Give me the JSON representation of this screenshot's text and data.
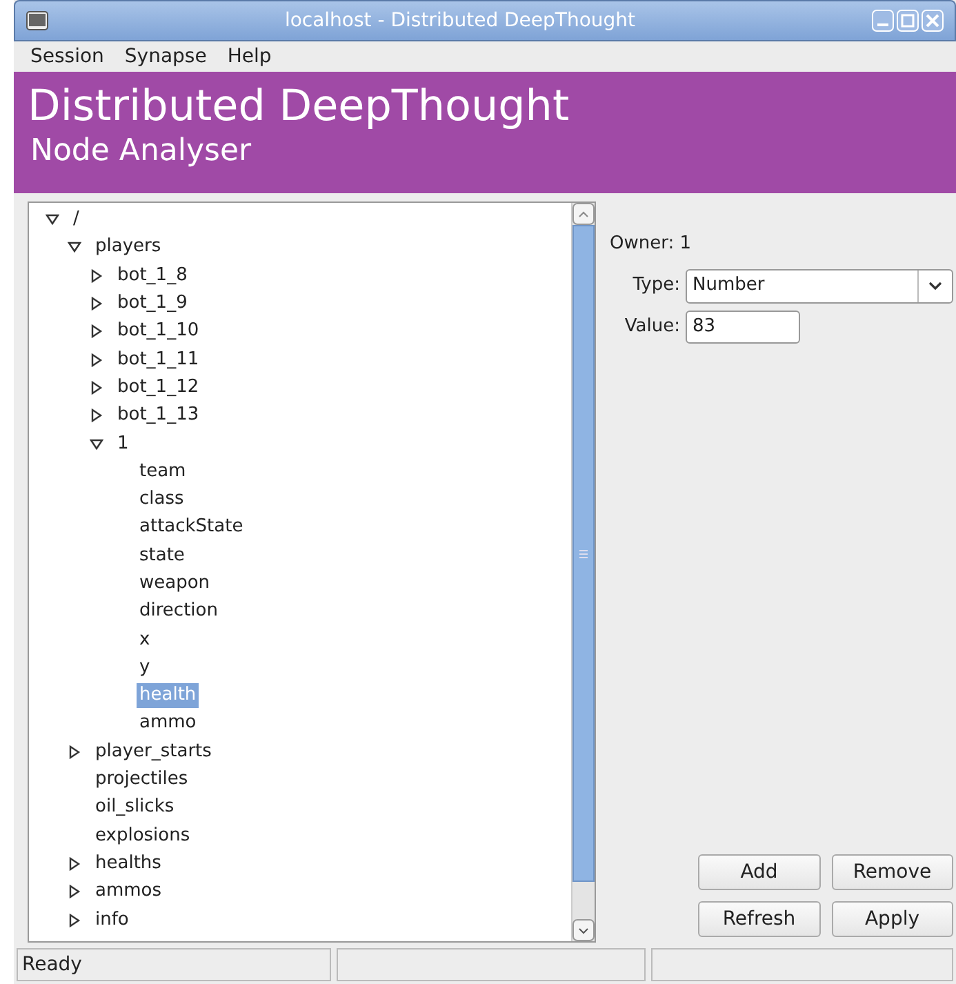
{
  "window": {
    "title": "localhost - Distributed DeepThought"
  },
  "menu": [
    "Session",
    "Synapse",
    "Help"
  ],
  "banner": {
    "title": "Distributed DeepThought",
    "subtitle": "Node Analyser"
  },
  "tree": [
    {
      "label": "/",
      "expanded": true,
      "selected": false,
      "children": [
        {
          "label": "players",
          "expanded": true,
          "selected": false,
          "children": [
            {
              "label": "bot_1_8",
              "expanded": false,
              "selected": false
            },
            {
              "label": "bot_1_9",
              "expanded": false,
              "selected": false
            },
            {
              "label": "bot_1_10",
              "expanded": false,
              "selected": false
            },
            {
              "label": "bot_1_11",
              "expanded": false,
              "selected": false
            },
            {
              "label": "bot_1_12",
              "expanded": false,
              "selected": false
            },
            {
              "label": "bot_1_13",
              "expanded": false,
              "selected": false
            },
            {
              "label": "1",
              "expanded": true,
              "selected": false,
              "children": [
                {
                  "label": "team",
                  "selected": false
                },
                {
                  "label": "class",
                  "selected": false
                },
                {
                  "label": "attackState",
                  "selected": false
                },
                {
                  "label": "state",
                  "selected": false
                },
                {
                  "label": "weapon",
                  "selected": false
                },
                {
                  "label": "direction",
                  "selected": false
                },
                {
                  "label": "x",
                  "selected": false
                },
                {
                  "label": "y",
                  "selected": false
                },
                {
                  "label": "health",
                  "selected": true
                },
                {
                  "label": "ammo",
                  "selected": false
                }
              ]
            }
          ]
        },
        {
          "label": "player_starts",
          "expanded": false,
          "selected": false
        },
        {
          "label": "projectiles",
          "selected": false
        },
        {
          "label": "oil_slicks",
          "selected": false
        },
        {
          "label": "explosions",
          "selected": false
        },
        {
          "label": "healths",
          "expanded": false,
          "selected": false
        },
        {
          "label": "ammos",
          "expanded": false,
          "selected": false
        },
        {
          "label": "info",
          "expanded": false,
          "selected": false
        }
      ]
    }
  ],
  "details": {
    "owner": "Owner: 1",
    "type_label": "Type:",
    "type_value": "Number",
    "value_label": "Value:",
    "value": "83"
  },
  "buttons": [
    "Add",
    "Remove",
    "Refresh",
    "Apply"
  ],
  "status_bar": {
    "message": "Ready"
  }
}
